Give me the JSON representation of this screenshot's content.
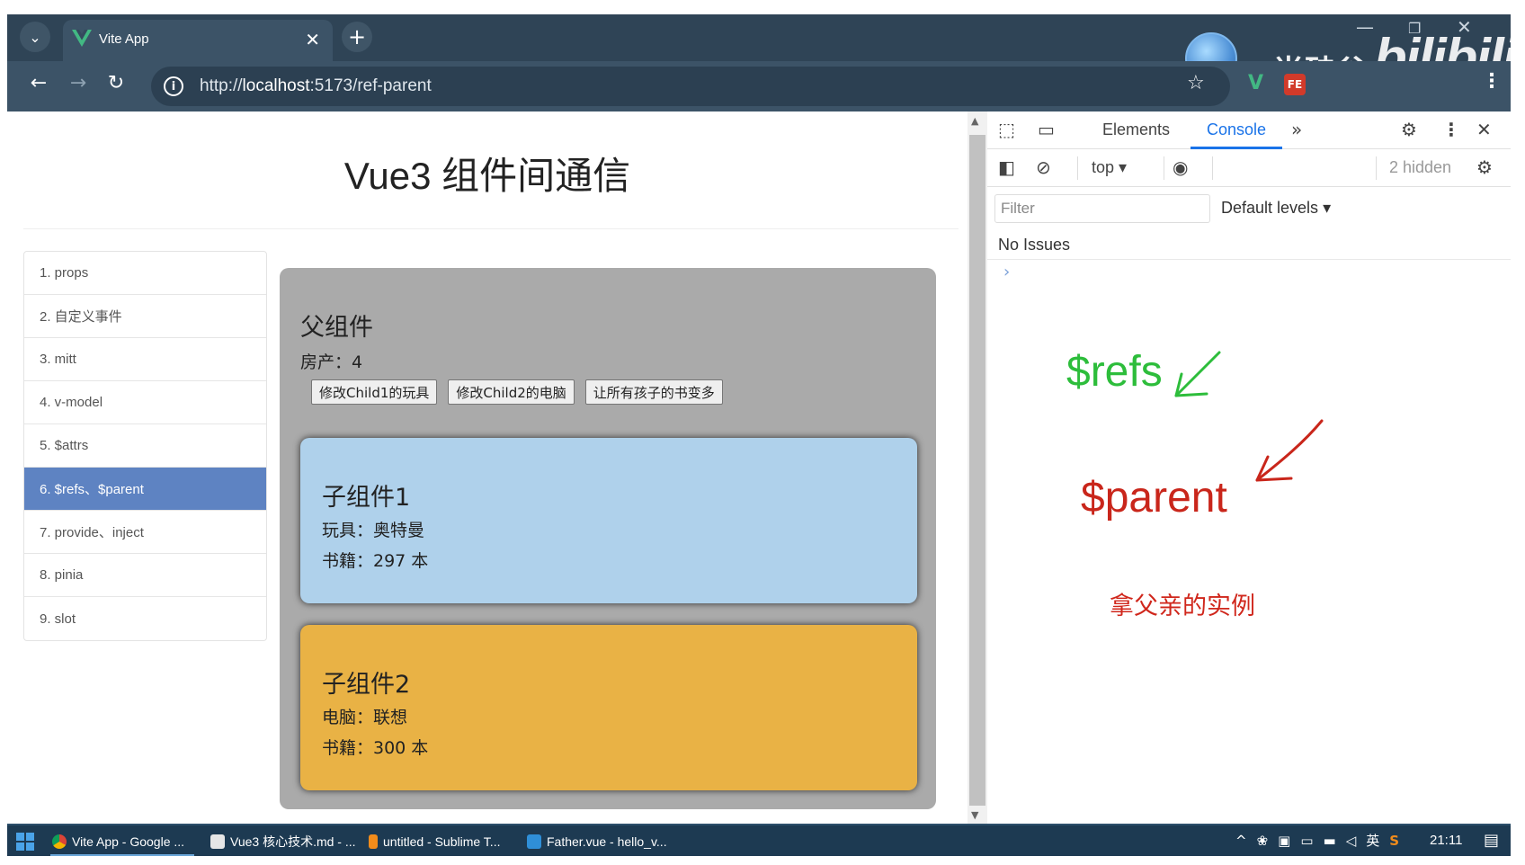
{
  "browser": {
    "tab_title": "Vite App",
    "url_prefix": "http://",
    "url_host": "localhost",
    "url_rest": ":5173/ref-parent"
  },
  "watermark": {
    "brand_text": "尚硅谷",
    "bili_text": "bilibili"
  },
  "page": {
    "title": "Vue3 组件间通信",
    "nav": [
      "1. props",
      "2. 自定义事件",
      "3. mitt",
      "4. v-model",
      "5. $attrs",
      "6. $refs、$parent",
      "7. provide、inject",
      "8. pinia",
      "9. slot"
    ],
    "active_nav_index": 5,
    "parent": {
      "title": "父组件",
      "house": "房产：4",
      "buttons": [
        "修改Child1的玩具",
        "修改Child2的电脑",
        "让所有孩子的书变多"
      ]
    },
    "child1": {
      "title": "子组件1",
      "line1": "玩具：奥特曼",
      "line2": "书籍：297 本"
    },
    "child2": {
      "title": "子组件2",
      "line1": "电脑：联想",
      "line2": "书籍：300 本"
    }
  },
  "devtools": {
    "tabs": [
      "Elements",
      "Console"
    ],
    "active_tab": "Console",
    "context": "top",
    "hidden": "2 hidden",
    "filter_placeholder": "Filter",
    "levels": "Default levels",
    "issues": "No Issues",
    "annotations": {
      "refs": "$refs",
      "parent": "$parent",
      "note": "拿父亲的实例"
    }
  },
  "taskbar": {
    "items": [
      "Vite App - Google ...",
      "Vue3 核心技术.md - ...",
      "untitled - Sublime T...",
      "Father.vue - hello_v..."
    ],
    "ime": "英",
    "clock": "21:11"
  },
  "colors": {
    "active_nav": "#5e83c2",
    "child1_bg": "#afd1eb",
    "child2_bg": "#e9b245",
    "parent_bg": "#aaaaaa",
    "refs_green": "#2dbd3b",
    "parent_red": "#c9261b",
    "devtools_accent": "#1a73e8"
  }
}
